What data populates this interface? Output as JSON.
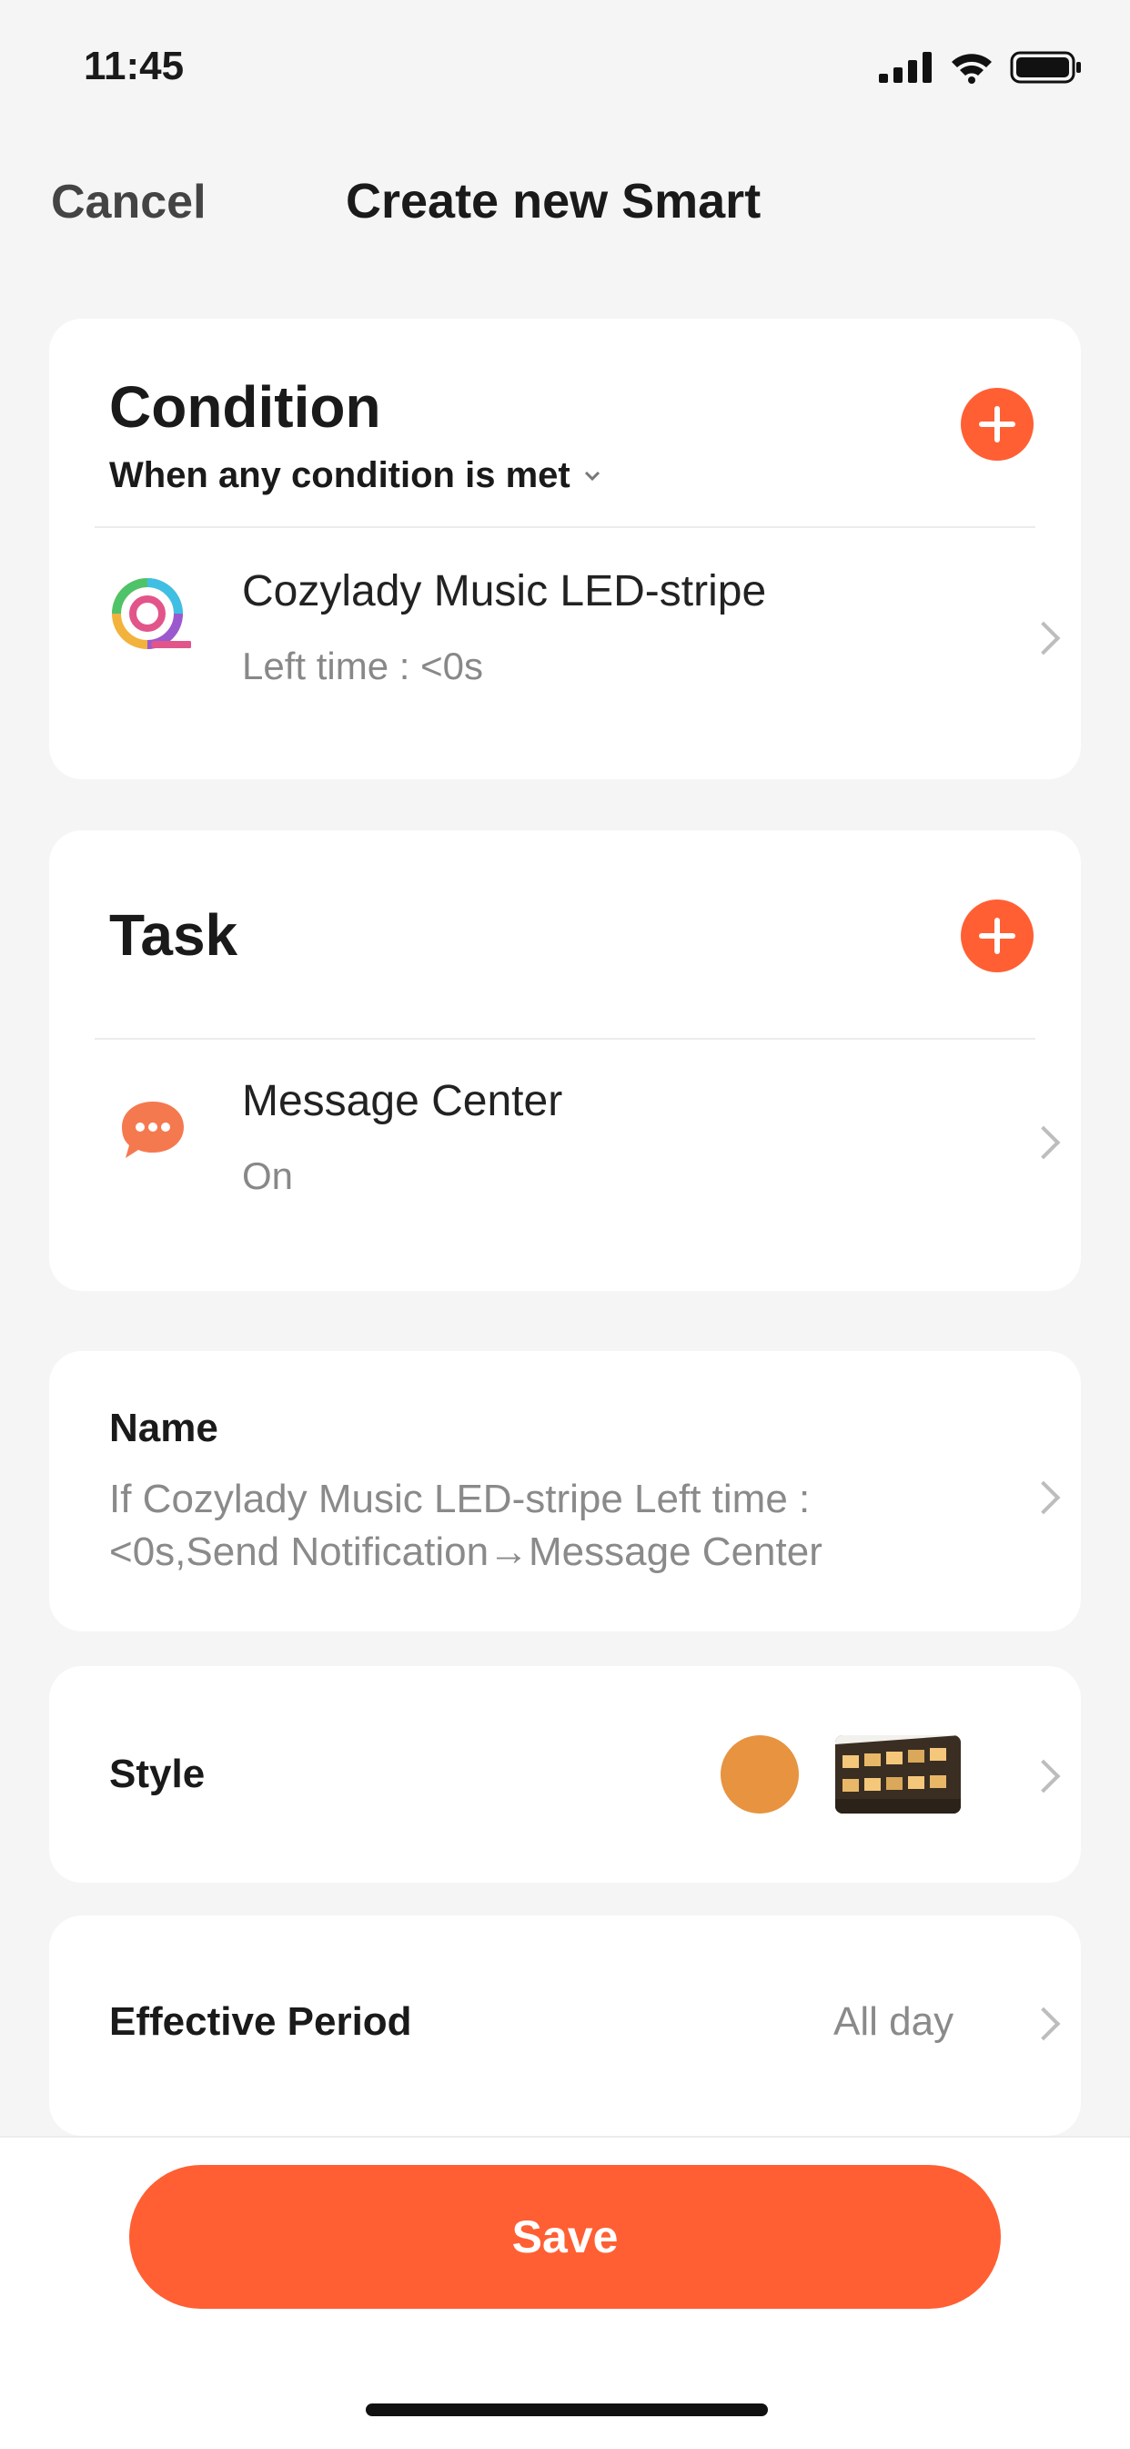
{
  "status_bar": {
    "time": "11:45"
  },
  "nav": {
    "cancel_label": "Cancel",
    "title": "Create new Smart"
  },
  "condition": {
    "title": "Condition",
    "mode": "When any condition is met",
    "items": [
      {
        "name": "Cozylady Music LED-stripe",
        "detail": "Left time : <0s",
        "icon": "led-stripe-icon"
      }
    ]
  },
  "task": {
    "title": "Task",
    "items": [
      {
        "name": "Message Center",
        "detail": "On",
        "icon": "message-icon"
      }
    ]
  },
  "name_section": {
    "label": "Name",
    "value": "If Cozylady Music LED-stripe Left time : <0s,Send Notification→Message Center"
  },
  "style_section": {
    "label": "Style",
    "color": "#e7933f"
  },
  "period_section": {
    "label": "Effective Period",
    "value": "All day"
  },
  "save_label": "Save",
  "colors": {
    "accent": "#ff5f33",
    "background": "#f5f5f5"
  }
}
